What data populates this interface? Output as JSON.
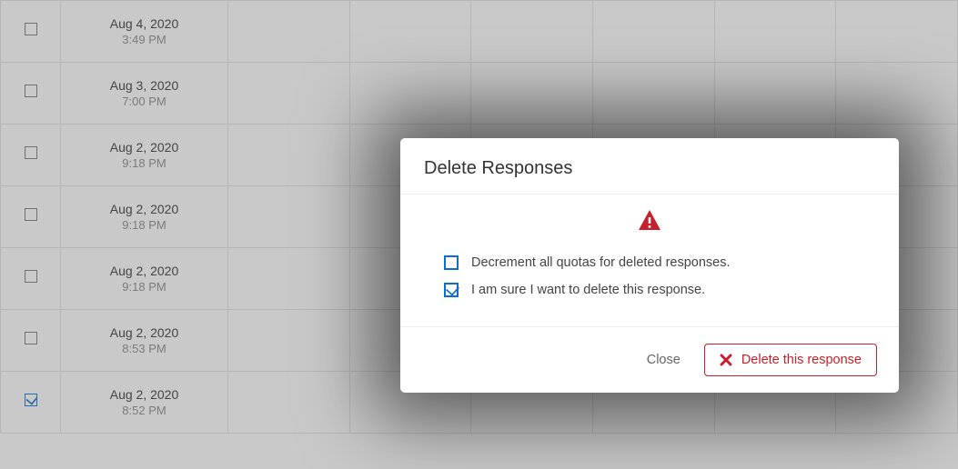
{
  "rows": [
    {
      "date": "Aug 4, 2020",
      "time": "3:49 PM",
      "checked": false
    },
    {
      "date": "Aug 3, 2020",
      "time": "7:00 PM",
      "checked": false
    },
    {
      "date": "Aug 2, 2020",
      "time": "9:18 PM",
      "checked": false
    },
    {
      "date": "Aug 2, 2020",
      "time": "9:18 PM",
      "checked": false
    },
    {
      "date": "Aug 2, 2020",
      "time": "9:18 PM",
      "checked": false
    },
    {
      "date": "Aug 2, 2020",
      "time": "8:53 PM",
      "checked": false
    },
    {
      "date": "Aug 2, 2020",
      "time": "8:52 PM",
      "checked": true
    }
  ],
  "blank_col_count": 6,
  "modal": {
    "title": "Delete Responses",
    "option1": {
      "label": "Decrement all quotas for deleted responses.",
      "checked": false
    },
    "option2": {
      "label": "I am sure I want to delete this response.",
      "checked": true
    },
    "close_label": "Close",
    "delete_label": "Delete this response"
  },
  "colors": {
    "danger": "#c81f2c",
    "primary": "#0b6dd7"
  }
}
